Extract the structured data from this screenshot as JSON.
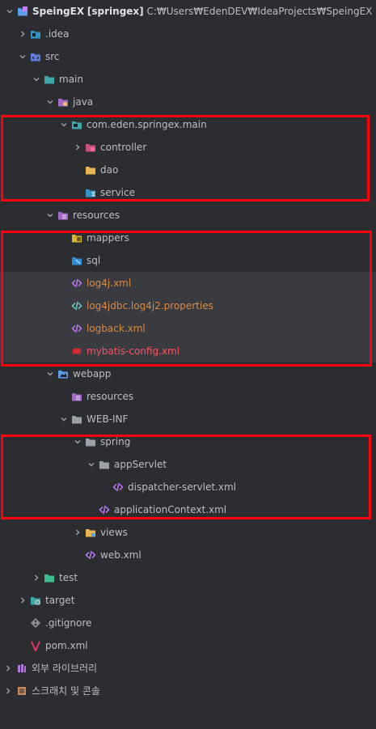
{
  "project": {
    "name": "SpeingEX",
    "module": "[springex]",
    "path": "C:₩Users₩EdenDEV₩IdeaProjects₩SpeingEX"
  },
  "tree": {
    "idea": ".idea",
    "src": "src",
    "main": "main",
    "java": "java",
    "package": "com.eden.springex.main",
    "controller": "controller",
    "dao": "dao",
    "service": "service",
    "resources": "resources",
    "mappers": "mappers",
    "sql": "sql",
    "log4j": "log4j.xml",
    "log4jdbc": "log4jdbc.log4j2.properties",
    "logback": "logback.xml",
    "mybatis": "mybatis-config.xml",
    "webapp": "webapp",
    "webapp_resources": "resources",
    "webinf": "WEB-INF",
    "spring": "spring",
    "appServlet": "appServlet",
    "dispatcher": "dispatcher-servlet.xml",
    "appContext": "applicationContext.xml",
    "views": "views",
    "webxml": "web.xml",
    "test": "test",
    "target": "target",
    "gitignore": ".gitignore",
    "pom": "pom.xml",
    "external_libs": "외부 라이브러리",
    "scratches": "스크래치 및 콘솔"
  },
  "colors": {
    "background": "#2b2d30",
    "highlight_row": "#393b40",
    "text": "#bcbec4",
    "orange_file": "#d88b47",
    "red_file": "#f75464",
    "annotation_box": "#ff0010"
  }
}
